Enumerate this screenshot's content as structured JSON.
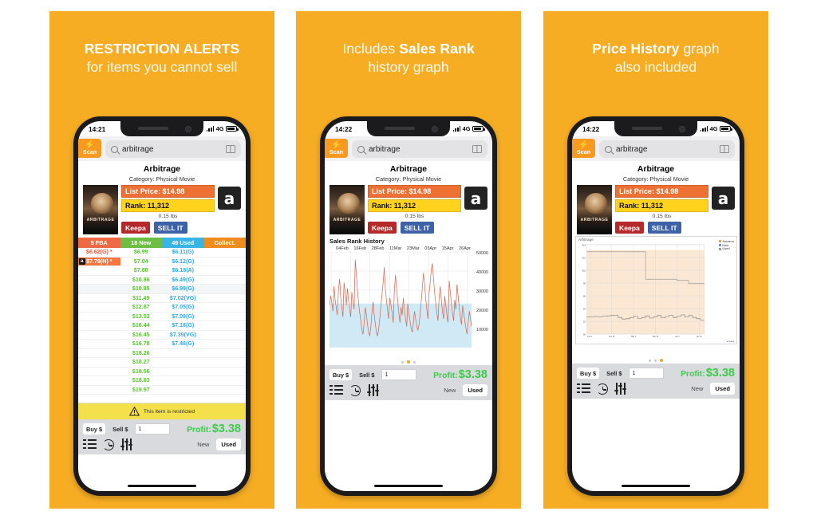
{
  "panels": [
    {
      "header": {
        "bold": "RESTRICTION ALERTS",
        "light": "for items you cannot sell",
        "bold_first": true
      },
      "status": {
        "time": "14:21",
        "network": "4G"
      },
      "dot_active": 0
    },
    {
      "header": {
        "pre": "Includes ",
        "bold": "Sales Rank",
        "light": "history graph",
        "bold_first": false
      },
      "status": {
        "time": "14:22",
        "network": "4G"
      },
      "dot_active": 1
    },
    {
      "header": {
        "bold": "Price History",
        "post": " graph",
        "light": "also included",
        "bold_first": true
      },
      "status": {
        "time": "14:22",
        "network": "4G"
      },
      "dot_active": 2
    }
  ],
  "app": {
    "scan_label": "Scan",
    "scan_icon": "bolt-icon",
    "search_value": "arbitrage",
    "search_placeholder": "Search",
    "book_icon": "book-icon",
    "product": {
      "title": "Arbitrage",
      "category": "Category: Physical Movie",
      "cover_title": "ARBITRAGE",
      "list_price_label": "List Price:  $14.98",
      "rank_label": "Rank: 11,312",
      "weight": "0.15 lbs",
      "keepa_label": "Keepa",
      "sellit_label": "SELL IT",
      "amazon_glyph": "a",
      "amazon_icon": "amazon-logo-icon"
    },
    "table": {
      "headers": [
        "5 FBA",
        "18 New",
        "49 Used",
        "Collect."
      ],
      "rows": [
        {
          "fba": "$6.62(G) *",
          "fba_hl": false,
          "fba_az": false,
          "new": "$6.99",
          "used": "$6.11(G)",
          "collect": ""
        },
        {
          "fba": "$7.79(N) *",
          "fba_hl": true,
          "fba_az": true,
          "new": "$7.04",
          "used": "$6.12(G)",
          "collect": ""
        },
        {
          "fba": "",
          "fba_hl": false,
          "fba_az": false,
          "new": "$7.88",
          "used": "$6.18(A)",
          "collect": ""
        },
        {
          "fba": "",
          "fba_hl": false,
          "fba_az": false,
          "new": "$10.86",
          "used": "$6.49(G)",
          "collect": ""
        },
        {
          "fba": "",
          "fba_hl": false,
          "fba_az": false,
          "new": "$10.95",
          "used": "$6.99(G)",
          "collect": ""
        },
        {
          "fba": "",
          "fba_hl": false,
          "fba_az": false,
          "new": "$11.49",
          "used": "$7.02(VG)",
          "collect": ""
        },
        {
          "fba": "",
          "fba_hl": false,
          "fba_az": false,
          "new": "$12.87",
          "used": "$7.05(G)",
          "collect": ""
        },
        {
          "fba": "",
          "fba_hl": false,
          "fba_az": false,
          "new": "$13.53",
          "used": "$7.09(G)",
          "collect": ""
        },
        {
          "fba": "",
          "fba_hl": false,
          "fba_az": false,
          "new": "$16.44",
          "used": "$7.18(G)",
          "collect": ""
        },
        {
          "fba": "",
          "fba_hl": false,
          "fba_az": false,
          "new": "$16.45",
          "used": "$7.39(VG)",
          "collect": ""
        },
        {
          "fba": "",
          "fba_hl": false,
          "fba_az": false,
          "new": "$16.78",
          "used": "$7.48(G)",
          "collect": ""
        },
        {
          "fba": "",
          "fba_hl": false,
          "fba_az": false,
          "new": "$18.26",
          "used": "",
          "collect": ""
        },
        {
          "fba": "",
          "fba_hl": false,
          "fba_az": false,
          "new": "$18.27",
          "used": "",
          "collect": ""
        },
        {
          "fba": "",
          "fba_hl": false,
          "fba_az": false,
          "new": "$18.56",
          "used": "",
          "collect": ""
        },
        {
          "fba": "",
          "fba_hl": false,
          "fba_az": false,
          "new": "$18.83",
          "used": "",
          "collect": ""
        },
        {
          "fba": "",
          "fba_hl": false,
          "fba_az": false,
          "new": "$19.97",
          "used": "",
          "collect": ""
        }
      ]
    },
    "restriction": {
      "text": "This item is restricted",
      "icon": "warning-triangle-icon"
    },
    "toolbar": {
      "buy_label": "Buy $",
      "sell_label": "Sell $",
      "qty_value": "1",
      "profit_label": "Profit:",
      "profit_value": "$3.38",
      "list_icon": "list-icon",
      "history_icon": "history-clock-icon",
      "settings_icon": "sliders-icon",
      "segments": [
        "New",
        "Used"
      ],
      "segment_active": "Used"
    }
  },
  "chart_data": [
    {
      "type": "line",
      "title": "Sales Rank History",
      "xlabel": "",
      "ylabel": "",
      "ylim": [
        0,
        50000
      ],
      "yticks": [
        10000,
        20000,
        30000,
        40000,
        50000
      ],
      "xtick_labels": [
        "04Feb",
        "16Feb",
        "28Feb",
        "11Mar",
        "23Mar",
        "03Apr",
        "15Apr",
        "26Apr"
      ],
      "grid": true,
      "legend": "none",
      "series": [
        {
          "name": "Sales Rank",
          "color": "#d9604a",
          "fill_color": "#cfe9f5",
          "values": [
            22000,
            27000,
            24000,
            19000,
            32000,
            25000,
            21000,
            17000,
            30000,
            36000,
            26000,
            21000,
            16000,
            34000,
            29000,
            22000,
            31000,
            25000,
            20000,
            16000,
            29000,
            24000,
            20000,
            46000,
            38000,
            30000,
            23000,
            18000,
            14000,
            9000,
            7000,
            13000,
            21000,
            17000,
            12000,
            8000,
            6000,
            11000,
            19000,
            24000,
            17000,
            12000,
            8000,
            6000,
            10000,
            16000,
            22000,
            28000,
            34000,
            42000,
            30000,
            24000,
            19000,
            15000,
            26000,
            22000,
            18000,
            13000,
            30000,
            38000,
            31000,
            24000,
            18000,
            13000,
            21000,
            17000,
            26000,
            20000,
            15000,
            11000,
            23000,
            18000,
            14000,
            10000,
            8000,
            13000,
            19000,
            15000,
            11000,
            9000,
            12000,
            17000,
            24000,
            31000,
            39000,
            33000,
            26000,
            20000,
            15000,
            28000,
            34000,
            41000,
            44000,
            36000,
            29000,
            23000,
            18000,
            14000,
            26000,
            32000,
            25000,
            19000,
            15000,
            27000,
            22000,
            17000,
            13000,
            35000,
            29000,
            23000,
            18000,
            14000,
            25000,
            20000,
            33000,
            27000,
            21000,
            16000,
            12000,
            22000,
            18000,
            14000,
            10000,
            7000,
            13000,
            19000,
            15000,
            11000
          ]
        }
      ]
    },
    {
      "type": "area",
      "title": "Arbitrage",
      "xlabel": "",
      "ylabel": "",
      "grid": true,
      "legend": "top-right",
      "legend_entries": [
        {
          "label": "Amazon",
          "color": "#f6a623"
        },
        {
          "label": "New",
          "color": "#7b8fcf"
        },
        {
          "label": "Used",
          "color": "#9a9a9a"
        }
      ],
      "xtick_labels": [
        "Feb 1",
        "Feb 15",
        "Mar 1",
        "Mar 15",
        "Apr 1",
        "Apr 15"
      ],
      "series": [
        {
          "name": "New",
          "color": "#8a8a96",
          "step": true,
          "values": [
            12.9,
            12.9,
            12.9,
            12.9,
            12.9,
            12.9,
            12.9,
            12.9,
            12.9,
            12.9,
            12.9,
            12.9,
            12.9,
            12.9,
            12.9,
            8.6,
            8.6,
            8.6,
            8.6,
            8.6,
            8.6,
            8.6,
            8.6,
            8.4,
            8.4,
            8.4,
            7.9,
            7.9,
            7.9,
            7.9
          ]
        },
        {
          "name": "Used",
          "color": "#6f6f76",
          "step": true,
          "values": [
            2.7,
            2.7,
            2.75,
            2.7,
            2.8,
            2.85,
            2.9,
            2.95,
            2.6,
            2.35,
            2.4,
            2.6,
            2.8,
            2.45,
            2.6,
            2.85,
            2.5,
            2.7,
            2.9,
            2.55,
            2.75,
            2.95,
            2.6,
            2.8,
            3.0,
            2.7,
            2.9,
            2.6,
            2.4,
            2.2
          ]
        }
      ]
    }
  ]
}
